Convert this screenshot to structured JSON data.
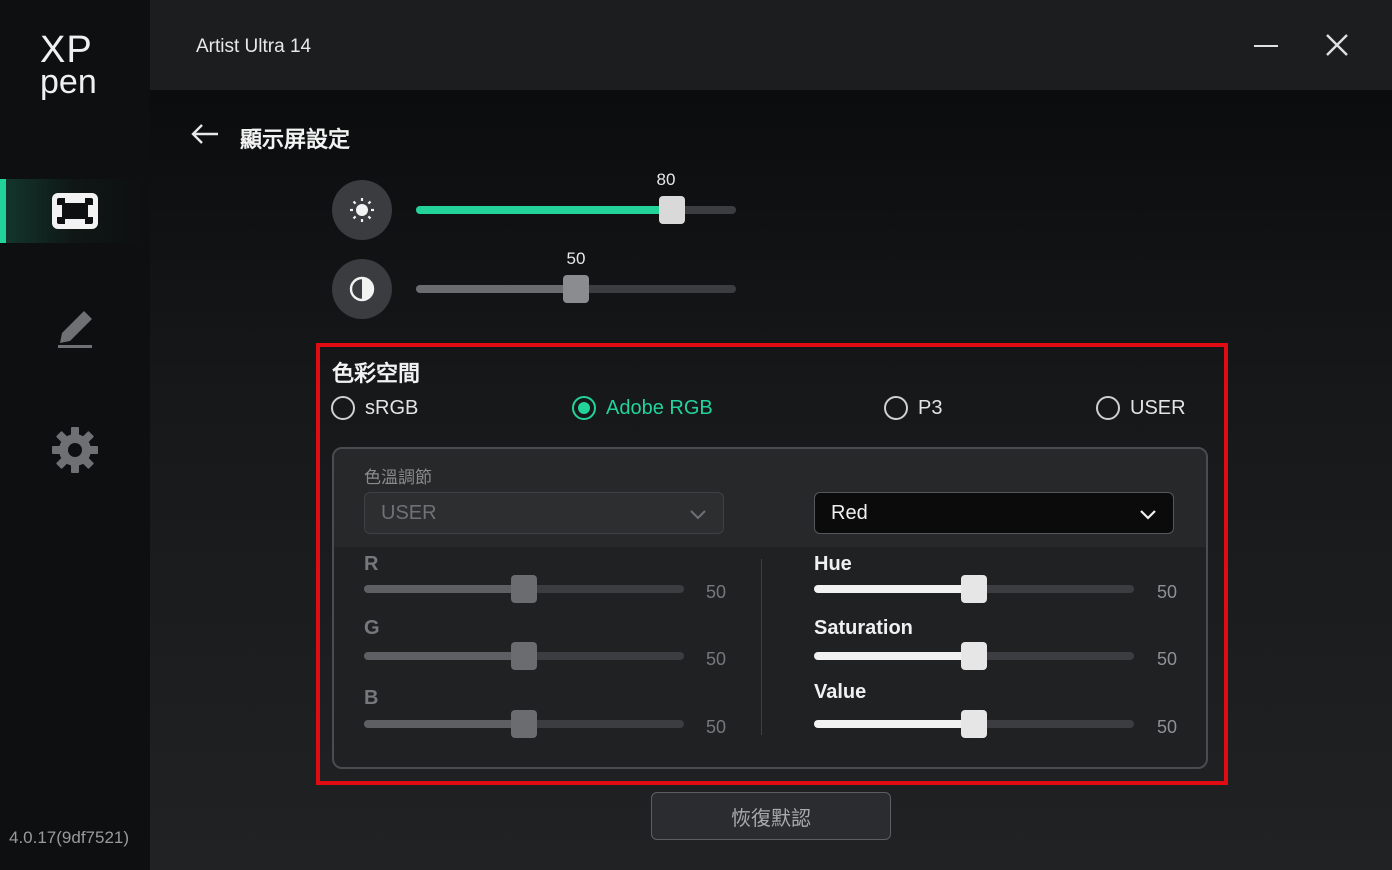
{
  "app": {
    "title": "Artist Ultra 14",
    "version": "4.0.17(9df7521)",
    "logo_top": "XP",
    "logo_bottom": "pen"
  },
  "sidebar": {
    "items": [
      {
        "name": "display",
        "icon": "display-frame-icon",
        "active": true
      },
      {
        "name": "pen",
        "icon": "pen-icon",
        "active": false
      },
      {
        "name": "settings",
        "icon": "gear-icon",
        "active": false
      }
    ]
  },
  "page": {
    "title": "顯示屏設定"
  },
  "brightness": {
    "icon": "sun-icon",
    "value": 80,
    "value_label": "80"
  },
  "contrast": {
    "icon": "contrast-icon",
    "value": 50,
    "value_label": "50"
  },
  "color_space": {
    "title": "色彩空間",
    "options": [
      "sRGB",
      "Adobe RGB",
      "P3",
      "USER"
    ],
    "selected": "Adobe RGB"
  },
  "color_temp": {
    "label": "色溫調節",
    "select_value": "USER",
    "channels": [
      {
        "label": "R",
        "value": 50,
        "value_label": "50"
      },
      {
        "label": "G",
        "value": 50,
        "value_label": "50"
      },
      {
        "label": "B",
        "value": 50,
        "value_label": "50"
      }
    ]
  },
  "color_adjust": {
    "select_value": "Red",
    "channels": [
      {
        "label": "Hue",
        "value": 50,
        "value_label": "50"
      },
      {
        "label": "Saturation",
        "value": 50,
        "value_label": "50"
      },
      {
        "label": "Value",
        "value": 50,
        "value_label": "50"
      }
    ]
  },
  "reset_label": "恢復默認",
  "colors": {
    "accent": "#22d39a",
    "highlight_border": "#e00b13"
  }
}
